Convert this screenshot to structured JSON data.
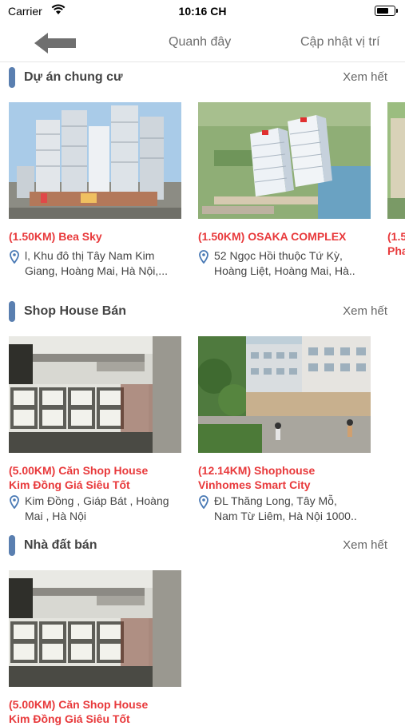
{
  "status_bar": {
    "carrier": "Carrier",
    "time": "10:16 CH"
  },
  "nav": {
    "around_label": "Quanh đây",
    "update_label": "Cập nhật vị trí"
  },
  "sections": [
    {
      "title": "Dự án chung cư",
      "see_all": "Xem hết",
      "cards": [
        {
          "title": "(1.50KM) Bea Sky",
          "address_line1": "l, Khu đô thị Tây Nam Kim",
          "address_line2": "Giang, Hoàng Mai, Hà Nội,..."
        },
        {
          "title": "(1.50KM) OSAKA COMPLEX",
          "address_line1": "52 Ngọc Hồi thuộc Tứ Kỳ,",
          "address_line2": "Hoàng Liệt, Hoàng Mai, Hà.."
        },
        {
          "title_line1": "(1.5",
          "title_line2": "Pha"
        }
      ]
    },
    {
      "title": "Shop House Bán",
      "see_all": "Xem hết",
      "cards": [
        {
          "title_line1": "(5.00KM) Căn Shop House",
          "title_line2": "Kim Đồng Giá Siêu Tốt",
          "address_line1": "Kim Đồng , Giáp Bát , Hoàng",
          "address_line2": "Mai , Hà Nội"
        },
        {
          "title_line1": "(12.14KM) Shophouse",
          "title_line2": "Vinhomes Smart City",
          "address_line1": "ĐL Thăng Long, Tây Mỗ,",
          "address_line2": "Nam Từ Liêm, Hà Nội 1000.."
        }
      ]
    },
    {
      "title": "Nhà đất bán",
      "see_all": "Xem hết",
      "cards": [
        {
          "title_line1": "(5.00KM) Căn Shop House",
          "title_line2": "Kim Đồng Giá Siêu Tốt"
        }
      ]
    }
  ],
  "colors": {
    "title_red": "#e8393b",
    "section_marker": "#5a7fb0",
    "pin_blue": "#4a7ab5"
  }
}
